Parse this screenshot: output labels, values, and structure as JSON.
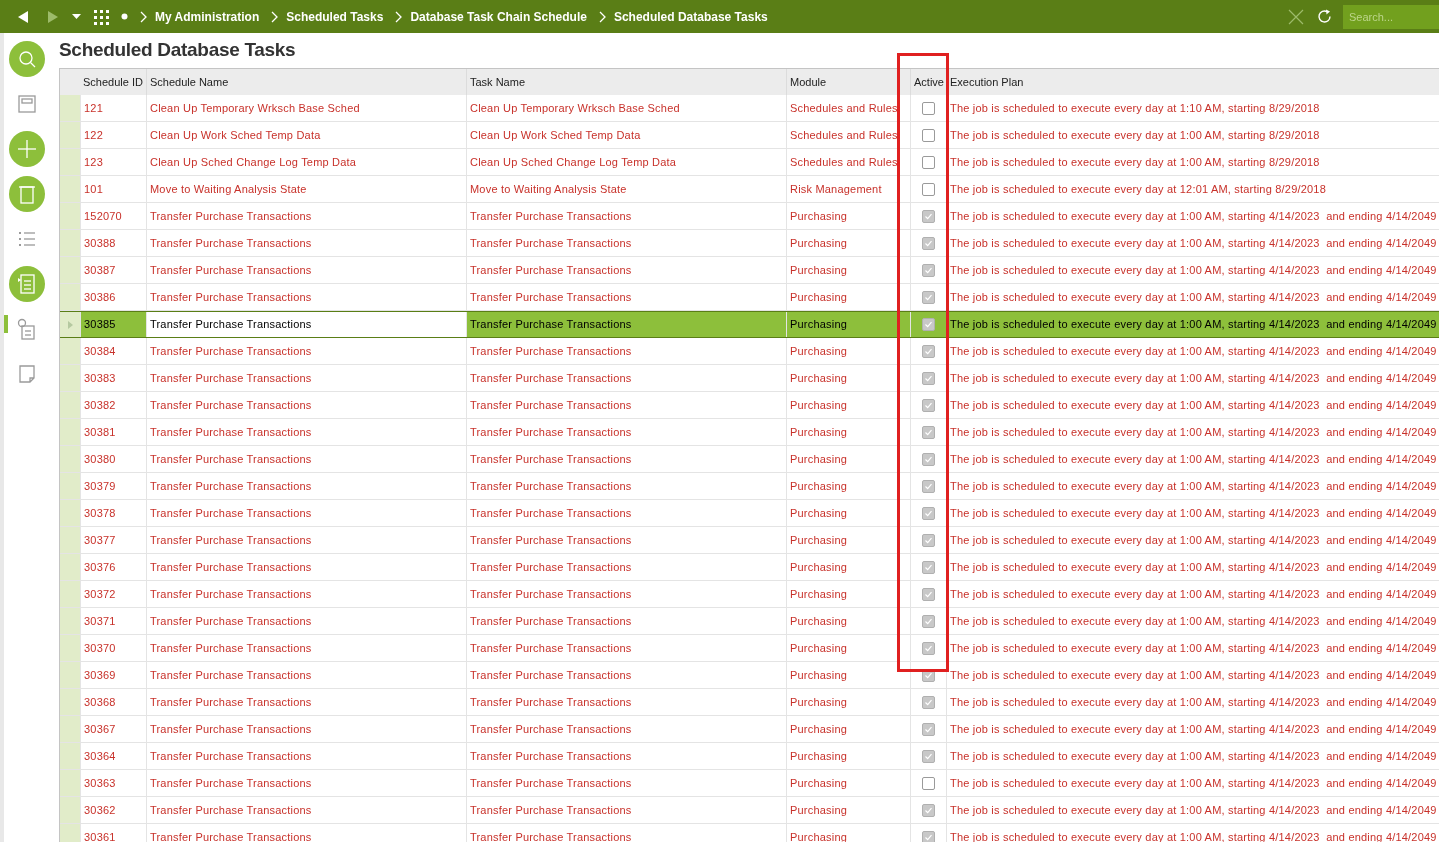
{
  "breadcrumbs": [
    "My Administration",
    "Scheduled Tasks",
    "Database Task Chain Schedule",
    "Scheduled Database Tasks"
  ],
  "search": {
    "placeholder": "Search..."
  },
  "sidebar": {
    "tools": [
      {
        "kind": "search",
        "filled": true,
        "selected": false
      },
      {
        "kind": "save",
        "filled": false,
        "selected": false
      },
      {
        "kind": "add",
        "filled": true,
        "selected": false
      },
      {
        "kind": "delete",
        "filled": true,
        "selected": false
      },
      {
        "kind": "list",
        "filled": false,
        "selected": false
      },
      {
        "kind": "detail",
        "filled": true,
        "selected": false
      },
      {
        "kind": "info",
        "filled": false,
        "selected": true
      },
      {
        "kind": "note",
        "filled": false,
        "selected": false
      }
    ]
  },
  "title": "Scheduled Database Tasks",
  "table": {
    "columns": [
      {
        "label": "Schedule ID",
        "highlighted": false
      },
      {
        "label": "Schedule Name",
        "highlighted": false
      },
      {
        "label": "Task Name",
        "highlighted": false
      },
      {
        "label": "Module",
        "highlighted": false
      },
      {
        "label": "Active",
        "highlighted": true
      },
      {
        "label": "Execution Plan",
        "highlighted": false
      }
    ],
    "rows": [
      {
        "id": "121",
        "schedule_name": "Clean Up Temporary Wrksch Base Sched",
        "task_name": "Clean Up Temporary Wrksch Base Sched",
        "module": "Schedules and Rules",
        "active": false,
        "plan": "The job is scheduled to execute every day at 1:10 AM, starting 8/29/2018",
        "selected": false
      },
      {
        "id": "122",
        "schedule_name": "Clean Up Work Sched Temp Data",
        "task_name": "Clean Up Work Sched Temp Data",
        "module": "Schedules and Rules",
        "active": false,
        "plan": "The job is scheduled to execute every day at 1:00 AM, starting 8/29/2018",
        "selected": false
      },
      {
        "id": "123",
        "schedule_name": "Clean Up Sched Change Log Temp Data",
        "task_name": "Clean Up Sched Change Log Temp Data",
        "module": "Schedules and Rules",
        "active": false,
        "plan": "The job is scheduled to execute every day at 1:00 AM, starting 8/29/2018",
        "selected": false
      },
      {
        "id": "101",
        "schedule_name": "Move to Waiting Analysis State",
        "task_name": "Move to Waiting Analysis State",
        "module": "Risk Management",
        "active": false,
        "plan": "The job is scheduled to execute every day at 12:01 AM, starting 8/29/2018",
        "selected": false
      },
      {
        "id": "152070",
        "schedule_name": "Transfer Purchase Transactions",
        "task_name": "Transfer Purchase Transactions",
        "module": "Purchasing",
        "active": true,
        "plan": "The job is scheduled to execute every day at 1:00 AM, starting 4/14/2023  and ending 4/14/2049",
        "selected": false
      },
      {
        "id": "30388",
        "schedule_name": "Transfer Purchase Transactions",
        "task_name": "Transfer Purchase Transactions",
        "module": "Purchasing",
        "active": true,
        "plan": "The job is scheduled to execute every day at 1:00 AM, starting 4/14/2023  and ending 4/14/2049",
        "selected": false
      },
      {
        "id": "30387",
        "schedule_name": "Transfer Purchase Transactions",
        "task_name": "Transfer Purchase Transactions",
        "module": "Purchasing",
        "active": true,
        "plan": "The job is scheduled to execute every day at 1:00 AM, starting 4/14/2023  and ending 4/14/2049",
        "selected": false
      },
      {
        "id": "30386",
        "schedule_name": "Transfer Purchase Transactions",
        "task_name": "Transfer Purchase Transactions",
        "module": "Purchasing",
        "active": true,
        "plan": "The job is scheduled to execute every day at 1:00 AM, starting 4/14/2023  and ending 4/14/2049",
        "selected": false
      },
      {
        "id": "30385",
        "schedule_name": "Transfer Purchase Transactions",
        "task_name": "Transfer Purchase Transactions",
        "module": "Purchasing",
        "active": true,
        "plan": "The job is scheduled to execute every day at 1:00 AM, starting 4/14/2023  and ending 4/14/2049",
        "selected": true
      },
      {
        "id": "30384",
        "schedule_name": "Transfer Purchase Transactions",
        "task_name": "Transfer Purchase Transactions",
        "module": "Purchasing",
        "active": true,
        "plan": "The job is scheduled to execute every day at 1:00 AM, starting 4/14/2023  and ending 4/14/2049",
        "selected": false
      },
      {
        "id": "30383",
        "schedule_name": "Transfer Purchase Transactions",
        "task_name": "Transfer Purchase Transactions",
        "module": "Purchasing",
        "active": true,
        "plan": "The job is scheduled to execute every day at 1:00 AM, starting 4/14/2023  and ending 4/14/2049",
        "selected": false
      },
      {
        "id": "30382",
        "schedule_name": "Transfer Purchase Transactions",
        "task_name": "Transfer Purchase Transactions",
        "module": "Purchasing",
        "active": true,
        "plan": "The job is scheduled to execute every day at 1:00 AM, starting 4/14/2023  and ending 4/14/2049",
        "selected": false
      },
      {
        "id": "30381",
        "schedule_name": "Transfer Purchase Transactions",
        "task_name": "Transfer Purchase Transactions",
        "module": "Purchasing",
        "active": true,
        "plan": "The job is scheduled to execute every day at 1:00 AM, starting 4/14/2023  and ending 4/14/2049",
        "selected": false
      },
      {
        "id": "30380",
        "schedule_name": "Transfer Purchase Transactions",
        "task_name": "Transfer Purchase Transactions",
        "module": "Purchasing",
        "active": true,
        "plan": "The job is scheduled to execute every day at 1:00 AM, starting 4/14/2023  and ending 4/14/2049",
        "selected": false
      },
      {
        "id": "30379",
        "schedule_name": "Transfer Purchase Transactions",
        "task_name": "Transfer Purchase Transactions",
        "module": "Purchasing",
        "active": true,
        "plan": "The job is scheduled to execute every day at 1:00 AM, starting 4/14/2023  and ending 4/14/2049",
        "selected": false
      },
      {
        "id": "30378",
        "schedule_name": "Transfer Purchase Transactions",
        "task_name": "Transfer Purchase Transactions",
        "module": "Purchasing",
        "active": true,
        "plan": "The job is scheduled to execute every day at 1:00 AM, starting 4/14/2023  and ending 4/14/2049",
        "selected": false
      },
      {
        "id": "30377",
        "schedule_name": "Transfer Purchase Transactions",
        "task_name": "Transfer Purchase Transactions",
        "module": "Purchasing",
        "active": true,
        "plan": "The job is scheduled to execute every day at 1:00 AM, starting 4/14/2023  and ending 4/14/2049",
        "selected": false
      },
      {
        "id": "30376",
        "schedule_name": "Transfer Purchase Transactions",
        "task_name": "Transfer Purchase Transactions",
        "module": "Purchasing",
        "active": true,
        "plan": "The job is scheduled to execute every day at 1:00 AM, starting 4/14/2023  and ending 4/14/2049",
        "selected": false
      },
      {
        "id": "30372",
        "schedule_name": "Transfer Purchase Transactions",
        "task_name": "Transfer Purchase Transactions",
        "module": "Purchasing",
        "active": true,
        "plan": "The job is scheduled to execute every day at 1:00 AM, starting 4/14/2023  and ending 4/14/2049",
        "selected": false
      },
      {
        "id": "30371",
        "schedule_name": "Transfer Purchase Transactions",
        "task_name": "Transfer Purchase Transactions",
        "module": "Purchasing",
        "active": true,
        "plan": "The job is scheduled to execute every day at 1:00 AM, starting 4/14/2023  and ending 4/14/2049",
        "selected": false
      },
      {
        "id": "30370",
        "schedule_name": "Transfer Purchase Transactions",
        "task_name": "Transfer Purchase Transactions",
        "module": "Purchasing",
        "active": true,
        "plan": "The job is scheduled to execute every day at 1:00 AM, starting 4/14/2023  and ending 4/14/2049",
        "selected": false
      },
      {
        "id": "30369",
        "schedule_name": "Transfer Purchase Transactions",
        "task_name": "Transfer Purchase Transactions",
        "module": "Purchasing",
        "active": true,
        "plan": "The job is scheduled to execute every day at 1:00 AM, starting 4/14/2023  and ending 4/14/2049",
        "selected": false
      },
      {
        "id": "30368",
        "schedule_name": "Transfer Purchase Transactions",
        "task_name": "Transfer Purchase Transactions",
        "module": "Purchasing",
        "active": true,
        "plan": "The job is scheduled to execute every day at 1:00 AM, starting 4/14/2023  and ending 4/14/2049",
        "selected": false
      },
      {
        "id": "30367",
        "schedule_name": "Transfer Purchase Transactions",
        "task_name": "Transfer Purchase Transactions",
        "module": "Purchasing",
        "active": true,
        "plan": "The job is scheduled to execute every day at 1:00 AM, starting 4/14/2023  and ending 4/14/2049",
        "selected": false
      },
      {
        "id": "30364",
        "schedule_name": "Transfer Purchase Transactions",
        "task_name": "Transfer Purchase Transactions",
        "module": "Purchasing",
        "active": true,
        "plan": "The job is scheduled to execute every day at 1:00 AM, starting 4/14/2023  and ending 4/14/2049",
        "selected": false
      },
      {
        "id": "30363",
        "schedule_name": "Transfer Purchase Transactions",
        "task_name": "Transfer Purchase Transactions",
        "module": "Purchasing",
        "active": false,
        "plan": "The job is scheduled to execute every day at 1:00 AM, starting 4/14/2023  and ending 4/14/2049",
        "selected": false
      },
      {
        "id": "30362",
        "schedule_name": "Transfer Purchase Transactions",
        "task_name": "Transfer Purchase Transactions",
        "module": "Purchasing",
        "active": true,
        "plan": "The job is scheduled to execute every day at 1:00 AM, starting 4/14/2023  and ending 4/14/2049",
        "selected": false
      },
      {
        "id": "30361",
        "schedule_name": "Transfer Purchase Transactions",
        "task_name": "Transfer Purchase Transactions",
        "module": "Purchasing",
        "active": true,
        "plan": "The job is scheduled to execute every day at 1:00 AM, starting 4/14/2023  and ending 4/14/2049",
        "selected": false
      }
    ]
  }
}
